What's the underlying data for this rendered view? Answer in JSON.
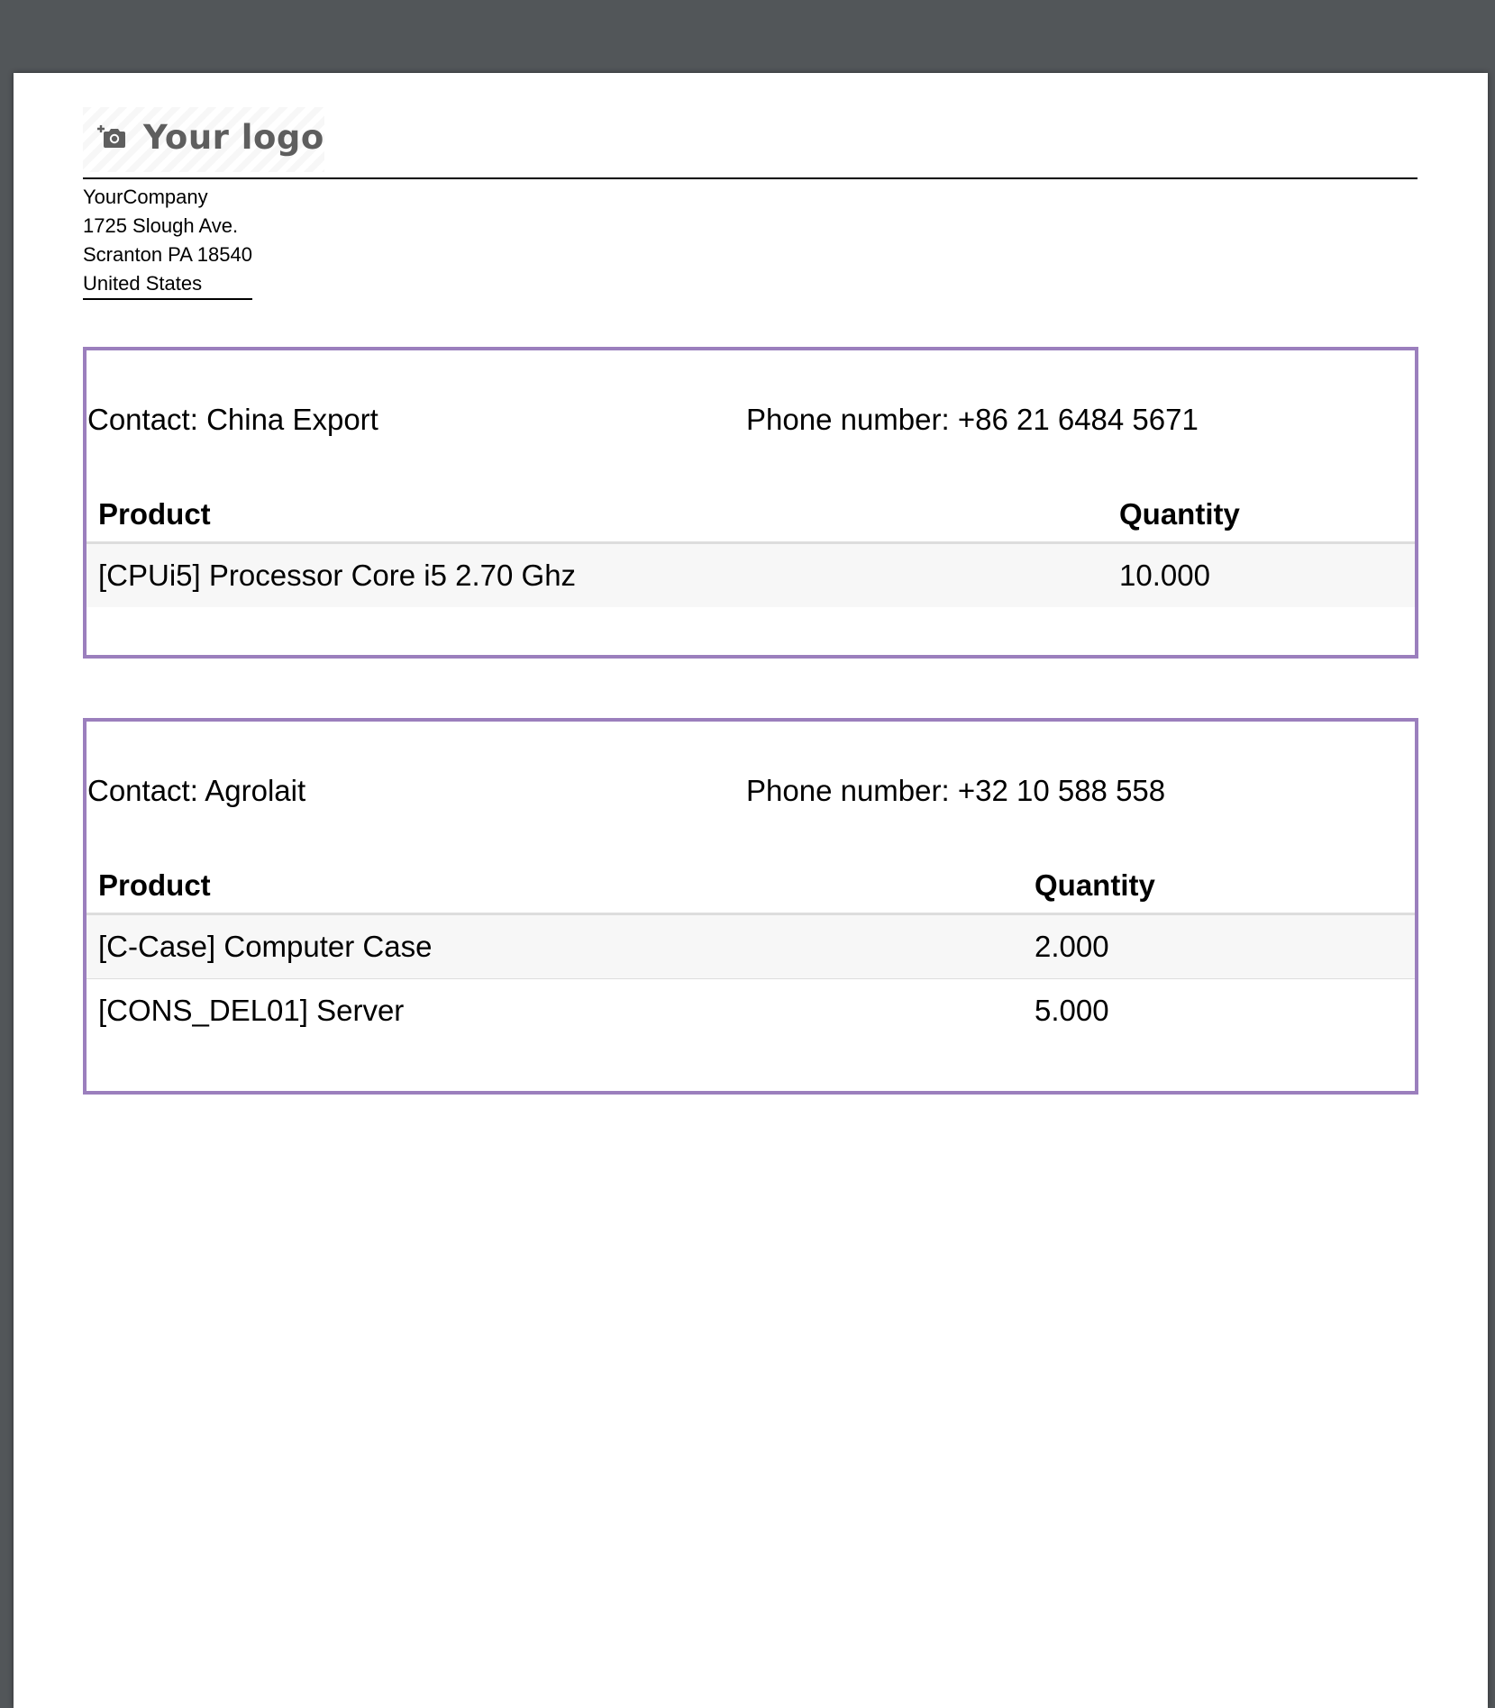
{
  "company": {
    "logo_text": "Your logo",
    "logo_icon": "camera-add-icon",
    "address_lines": [
      "YourCompany",
      "1725 Slough Ave.",
      "Scranton PA 18540",
      "United States"
    ]
  },
  "partners": [
    {
      "contact": "Contact: China Export",
      "phone": "Phone number: +86 21 6484 5671",
      "headers": {
        "product": "Product",
        "quantity": "Quantity"
      },
      "lines": [
        {
          "product": "[CPUi5] Processor Core i5 2.70 Ghz",
          "quantity": "10.000"
        }
      ]
    },
    {
      "contact": "Contact: Agrolait",
      "phone": "Phone number: +32 10 588 558",
      "headers": {
        "product": "Product",
        "quantity": "Quantity"
      },
      "lines": [
        {
          "product": "[C-Case] Computer Case",
          "quantity": "2.000"
        },
        {
          "product": "[CONS_DEL01] Server",
          "quantity": "5.000"
        }
      ]
    }
  ],
  "colors": {
    "viewer_background": "#525659",
    "partner_border": "#9b7fbd",
    "row_shade": "#f7f7f7"
  }
}
